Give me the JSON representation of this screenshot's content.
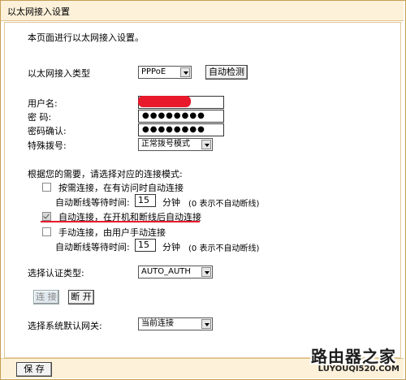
{
  "title": "以太网接入设置",
  "intro": "本页面进行以太网接入设置。",
  "conn_type": {
    "label": "以太网接入类型",
    "value": "PPPoE",
    "detect_button": "自动检测"
  },
  "username": {
    "label": "用户名:"
  },
  "password": {
    "label": "密  码:",
    "masked": "●●●●●●●●"
  },
  "password_confirm": {
    "label": "密码确认:",
    "masked": "●●●●●●●●"
  },
  "dial": {
    "label": "特殊拨号:",
    "value": "正常拨号模式"
  },
  "mode_prompt": "根据您的需要，请选择对应的连接模式:",
  "modes": [
    {
      "label": "按需连接，在有访问时自动连接",
      "checked": false
    },
    {
      "label": "自动连接，在开机和断线后自动连接",
      "checked": true
    },
    {
      "label": "手动连接，由用户手动连接",
      "checked": false
    }
  ],
  "idle1": {
    "label": "自动断线等待时间:",
    "value": "15",
    "unit": "分钟",
    "note": "(0 表示不自动断线)"
  },
  "idle2": {
    "label": "自动断线等待时间:",
    "value": "15",
    "unit": "分钟",
    "note": "(0 表示不自动断线)"
  },
  "auth": {
    "label": "选择认证类型:",
    "value": "AUTO_AUTH"
  },
  "connect_button": "连 接",
  "disconnect_button": "断 开",
  "gateway": {
    "label": "选择系统默认网关:",
    "value": "当前连接"
  },
  "save_button": "保 存",
  "watermark": {
    "line1": "路由器之家",
    "line2": "LUYOUQI520.COM"
  },
  "colors": {
    "frame": "#c89c54",
    "titlebar": "#fdf1d9",
    "annotation": "#e8192b"
  }
}
